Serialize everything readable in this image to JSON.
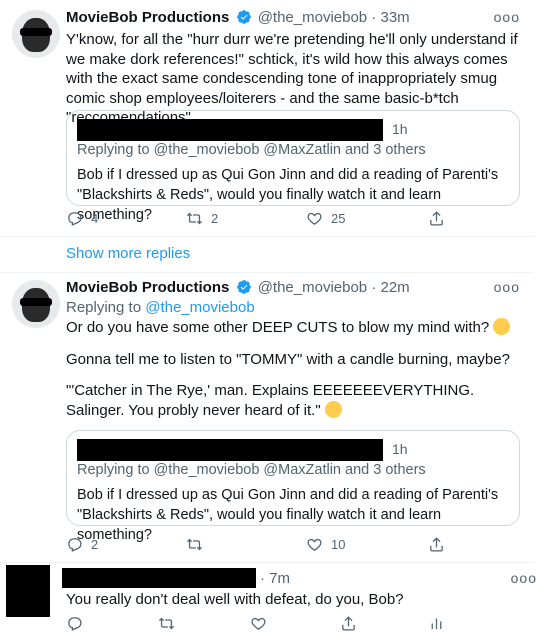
{
  "tweet1": {
    "name": "MovieBob Productions",
    "handle": "@the_moviebob",
    "dot": "·",
    "time": "33m",
    "text": "Y'know, for all the \"hurr durr we're pretending he'll only understand if we make dork references!\" schtick, it's wild how this always comes with the exact same condescending tone of inappropriately smug comic shop employees/loiterers - and the same basic-b*tch \"reccomendations\"",
    "quote": {
      "time": "1h",
      "reply_prefix": "Replying to",
      "reply_handles": "@the_moviebob @MaxZatlin",
      "reply_suffix": "and 3 others",
      "text": "Bob if I dressed up as Qui Gon Jinn and did a reading of Parenti's \"Blackshirts & Reds\", would you finally watch it and learn something?"
    },
    "replies": "4",
    "retweets": "2",
    "likes": "25"
  },
  "show_more": "Show more replies",
  "tweet2": {
    "name": "MovieBob Productions",
    "handle": "@the_moviebob",
    "dot": "·",
    "time": "22m",
    "reply_prefix": "Replying to",
    "reply_handle": "@the_moviebob",
    "line1": "Or do you have some other DEEP CUTS to blow my mind with?",
    "line2": "Gonna tell me to listen to \"TOMMY\" with a candle burning, maybe?",
    "line3": "\"'Catcher in The Rye,' man. Explains EEEEEEEVERYTHING. Salinger. You probly never heard of it.\"",
    "quote": {
      "time": "1h",
      "reply_prefix": "Replying to",
      "reply_handles": "@the_moviebob @MaxZatlin",
      "reply_suffix": "and 3 others",
      "text": "Bob if I dressed up as Qui Gon Jinn and did a reading of Parenti's \"Blackshirts & Reds\", would you finally watch it and learn something?"
    },
    "replies": "2",
    "likes": "10"
  },
  "tweet3": {
    "dot": "·",
    "time": "7m",
    "text": "You really don't deal well with defeat, do you, Bob?"
  },
  "more_glyph": "ooo",
  "colors": {
    "accent": "#1d9bf0",
    "muted": "#536471",
    "text": "#0f1419",
    "border": "#cfd9de"
  }
}
